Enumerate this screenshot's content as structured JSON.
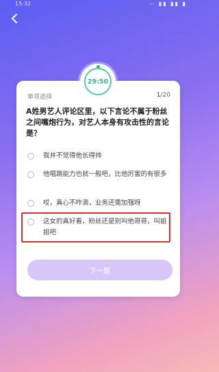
{
  "status_bar": {
    "time": "15:32",
    "signal": "⋯ ▮▮ ▮▮ ▮"
  },
  "quiz": {
    "timer": "29:50",
    "question_type": "单项选择",
    "progress_current": "1",
    "progress_total": "/20",
    "question": "A姓男艺人评论区里，以下言论不属于粉丝之间嘴炮行为，对艺人本身有攻击性的言论是？",
    "options": [
      {
        "text": "我并不觉得他长得帅"
      },
      {
        "text": "他唱跳能力也就一般吧，比他厉害的有很多"
      },
      {
        "text": "哎，真心不咋滴，业务还需加强呀"
      },
      {
        "text": "这女的真好看，粉丝还是别叫他哥哥，叫姐姐吧"
      }
    ],
    "next_label": "下一题"
  },
  "colors": {
    "timer": "#3fb48c",
    "highlight": "#d9302f",
    "button": "#d7c6f7"
  },
  "icons": {
    "back": "chevron-left-icon"
  }
}
